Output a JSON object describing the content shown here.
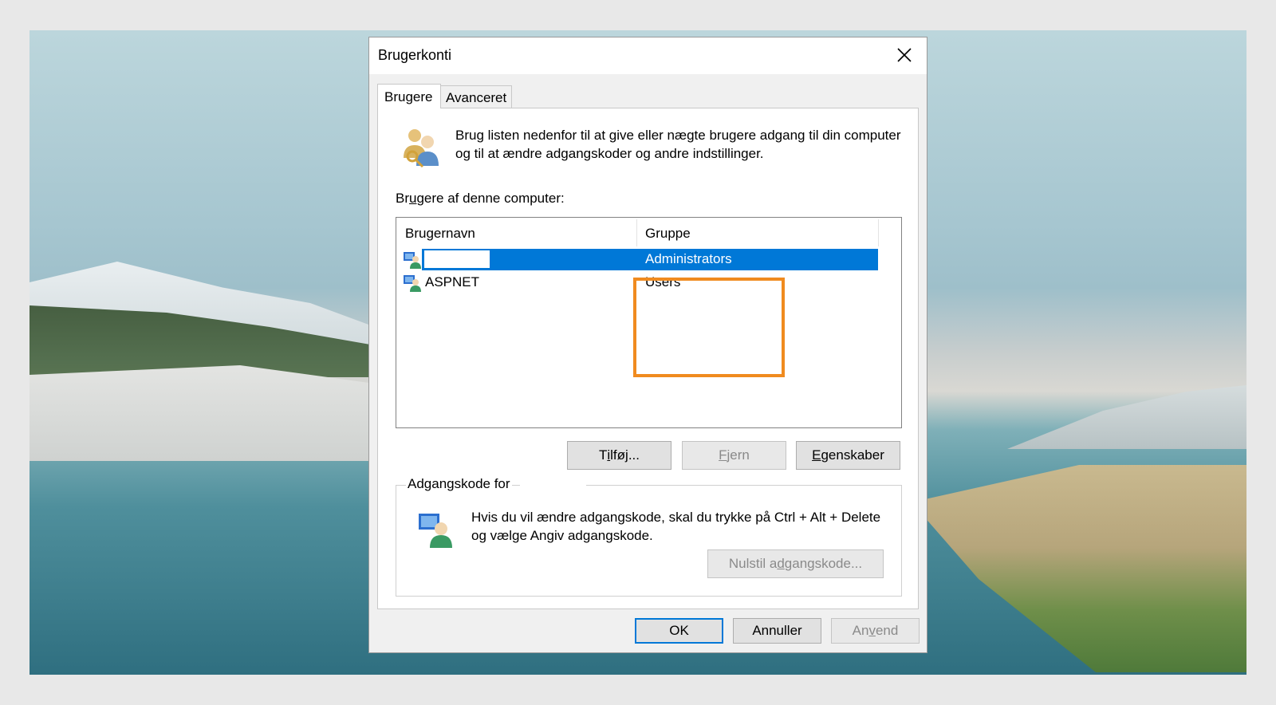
{
  "window": {
    "title": "Brugerkonti",
    "close_icon": "close-icon"
  },
  "tabs": [
    {
      "label": "Brugere",
      "active": true
    },
    {
      "label": "Avanceret",
      "active": false
    }
  ],
  "info": {
    "text": "Brug listen nedenfor til at give eller nægte brugere adgang til din computer og til at ændre adgangskoder og andre indstillinger.",
    "icon": "users-key-icon"
  },
  "users_section": {
    "label_pre": "Br",
    "label_u": "u",
    "label_post": "gere af denne computer:",
    "columns": [
      "Brugernavn",
      "Gruppe"
    ],
    "rows": [
      {
        "name": "",
        "group": "Administrators",
        "selected": true,
        "icon": "user-icon"
      },
      {
        "name": "ASPNET",
        "group": "Users",
        "selected": false,
        "icon": "user-icon"
      }
    ]
  },
  "buttons": {
    "add": {
      "pre": "T",
      "u": "i",
      "post": "lføj..."
    },
    "remove": {
      "pre": "",
      "u": "F",
      "post": "jern",
      "disabled": true
    },
    "properties": {
      "pre": "",
      "u": "E",
      "post": "genskaber"
    }
  },
  "password_section": {
    "label": "Adgangskode for",
    "text": "Hvis du vil ændre adgangskode, skal du trykke på Ctrl + Alt + Delete og vælge Angiv adgangskode.",
    "icon": "user-password-icon",
    "reset_button": {
      "pre": "Nulstil a",
      "u": "d",
      "post": "gangskode...",
      "disabled": true
    }
  },
  "footer": {
    "ok": "OK",
    "cancel": "Annuller",
    "apply": {
      "pre": "An",
      "u": "v",
      "post": "end",
      "disabled": true
    }
  },
  "highlight_color": "#f08b1f",
  "selection_color": "#0078d7"
}
